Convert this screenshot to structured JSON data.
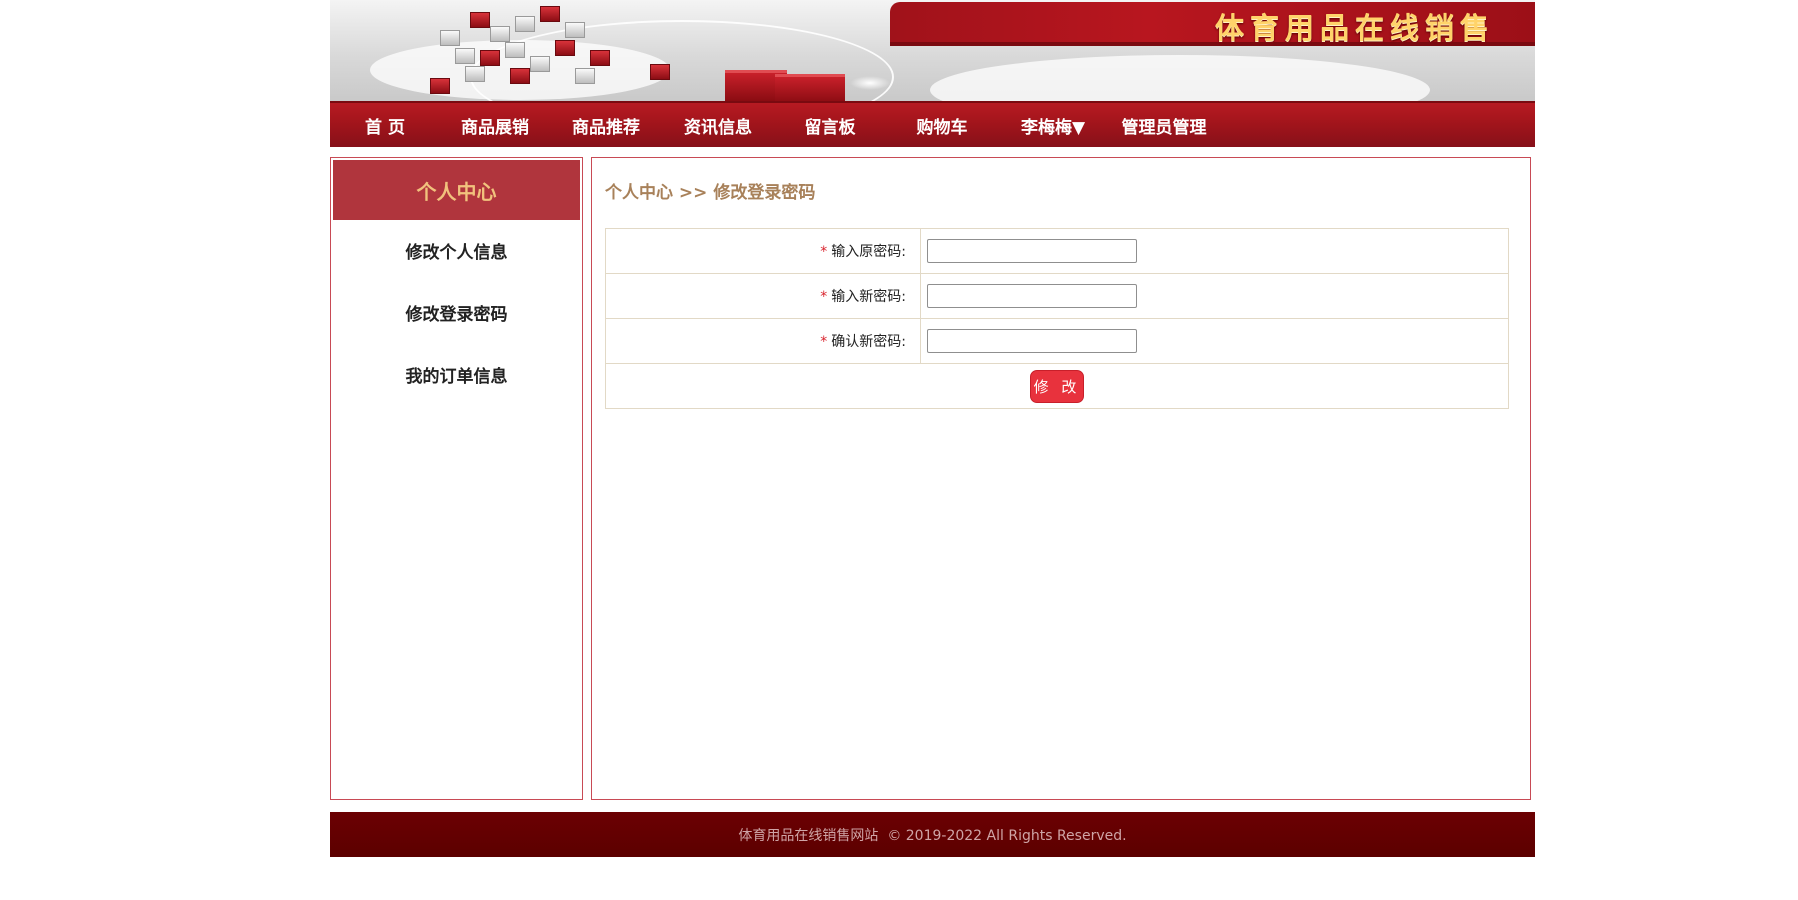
{
  "banner": {
    "site_title": "体育用品在线销售"
  },
  "nav": {
    "items": [
      {
        "label": "首 页"
      },
      {
        "label": "商品展销"
      },
      {
        "label": "商品推荐"
      },
      {
        "label": "资讯信息"
      },
      {
        "label": "留言板"
      },
      {
        "label": "购物车"
      },
      {
        "label": "李梅梅▼"
      },
      {
        "label": "管理员管理"
      }
    ]
  },
  "sidebar": {
    "title": "个人中心",
    "items": [
      {
        "label": "修改个人信息"
      },
      {
        "label": "修改登录密码"
      },
      {
        "label": "我的订单信息"
      }
    ]
  },
  "content": {
    "breadcrumb": "个人中心 >> 修改登录密码",
    "form": {
      "required_mark": "*",
      "fields": [
        {
          "label": "输入原密码:",
          "value": ""
        },
        {
          "label": "输入新密码:",
          "value": ""
        },
        {
          "label": "确认新密码:",
          "value": ""
        }
      ],
      "submit_label": "修 改"
    }
  },
  "footer": {
    "text": "体育用品在线销售网站  © 2019-2022 All Rights Reserved."
  },
  "colors": {
    "brand_red": "#a0141b",
    "footer_red": "#5c0000",
    "sidebar_header": "#b0353d",
    "breadcrumb": "#a8815a",
    "button": "#e8323d"
  }
}
